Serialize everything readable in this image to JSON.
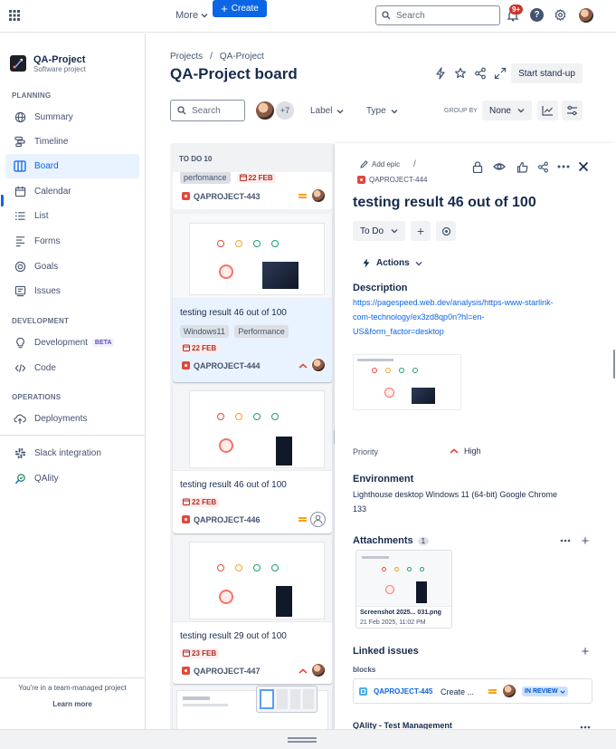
{
  "topbar": {
    "more_label": "More",
    "create_label": "Create",
    "search_placeholder": "Search",
    "notif_count": "9+"
  },
  "project": {
    "name": "QA-Project",
    "type": "Software project"
  },
  "sidebar": {
    "planning_header": "PLANNING",
    "development_header": "DEVELOPMENT",
    "operations_header": "OPERATIONS",
    "items": [
      {
        "label": "Summary"
      },
      {
        "label": "Timeline"
      },
      {
        "label": "Board"
      },
      {
        "label": "Calendar"
      },
      {
        "label": "List"
      },
      {
        "label": "Forms"
      },
      {
        "label": "Goals"
      },
      {
        "label": "Issues"
      },
      {
        "label": "Development",
        "badge": "BETA"
      },
      {
        "label": "Code"
      },
      {
        "label": "Deployments"
      },
      {
        "label": "Slack integration"
      },
      {
        "label": "QAlity"
      }
    ],
    "footer_text": "You're in a team-managed project",
    "learn_more": "Learn more"
  },
  "board": {
    "breadcrumb": [
      "Projects",
      "/",
      "QA-Project"
    ],
    "title": "QA-Project board",
    "standup_label": "Start stand-up",
    "search_placeholder": "Search",
    "avatar_more": "+7",
    "label_filter": "Label",
    "type_filter": "Type",
    "group_by_label": "GROUP BY",
    "group_by_value": "None",
    "column_title": "TO DO 10"
  },
  "cards": [
    {
      "label": "perfomance",
      "date": "22 FEB",
      "key": "QAPROJECT-443"
    },
    {
      "title": "testing result 46 out of 100",
      "labels": [
        "Windows11",
        "Performance"
      ],
      "date": "22 FEB",
      "key": "QAPROJECT-444"
    },
    {
      "title": "testing result 46 out of 100",
      "date": "22 FEB",
      "key": "QAPROJECT-446"
    },
    {
      "title": "testing result 29 out of 100",
      "date": "23 FEB",
      "key": "QAPROJECT-447"
    }
  ],
  "panel": {
    "add_epic": "Add epic",
    "slash": "/",
    "issue_key": "QAPROJECT-444",
    "title": "testing result 46 out of 100",
    "status": "To Do",
    "actions_label": "Actions",
    "description_label": "Description",
    "description_link": "https://pagespeed.web.dev/analysis/https-www-starlink-com-technology/ex3zd8qp0n?hl=en-US&form_factor=desktop",
    "description_lines": [
      "https://pagespeed.web.dev/analysis/https-www-starlink-",
      "com-technology/ex3zd8qp0n?hl=en-",
      "US&form_factor=desktop"
    ],
    "priority_label": "Priority",
    "priority_value": "High",
    "environment_label": "Environment",
    "environment_lines": [
      "Lighthouse desktop Windows 11 (64-bit) Google Chrome",
      "133"
    ],
    "attachments_label": "Attachments",
    "attachments_count": "1",
    "attachment_name": "Screenshot 2025... 031.png",
    "attachment_date": "21 Feb 2025, 11:02 PM",
    "linked_label": "Linked issues",
    "blocks_label": "blocks",
    "linked_key": "QAPROJECT-445",
    "linked_title": "Create ...",
    "linked_status": "IN REVIEW",
    "qality_label": "QAlity - Test Management"
  },
  "colors": {
    "accent": "#0c66e4",
    "danger": "#c9372c",
    "priority_high": "#e2483d",
    "medium": "#ff9f1a"
  }
}
